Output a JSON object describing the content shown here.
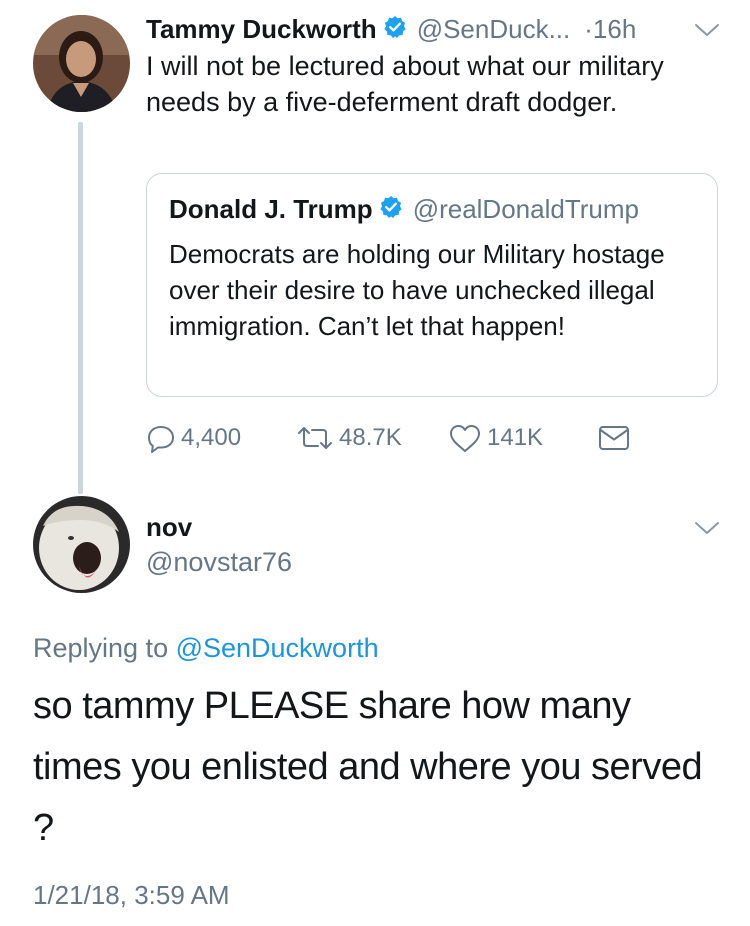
{
  "tweet1": {
    "name": "Tammy Duckworth",
    "handle": "@SenDuck...",
    "time": "·16h",
    "text": "I will not be lectured about what our military needs by a five-deferment draft dodger."
  },
  "quoted": {
    "name": "Donald J. Trump",
    "handle": "@realDonaldTrump",
    "text": "Democrats are holding our Military hostage over their desire to have unchecked illegal immigration. Can’t let that happen!"
  },
  "actions": {
    "replies": "4,400",
    "retweets": "48.7K",
    "likes": "141K"
  },
  "tweet2": {
    "name": "nov",
    "handle": "@novstar76",
    "reply_prefix": "Replying to ",
    "reply_mention": "@SenDuckworth",
    "text": "so tammy PLEASE share how many times you enlisted and where you served ?",
    "timestamp": "1/21/18, 3:59 AM"
  },
  "colors": {
    "verified": "#1da1f2",
    "secondary_text": "#657786",
    "link": "#1b95e0",
    "thread_line": "#ccd6dd"
  },
  "icons": [
    "verified-badge-icon",
    "chevron-down-icon",
    "reply-icon",
    "retweet-icon",
    "like-icon",
    "direct-message-icon"
  ]
}
